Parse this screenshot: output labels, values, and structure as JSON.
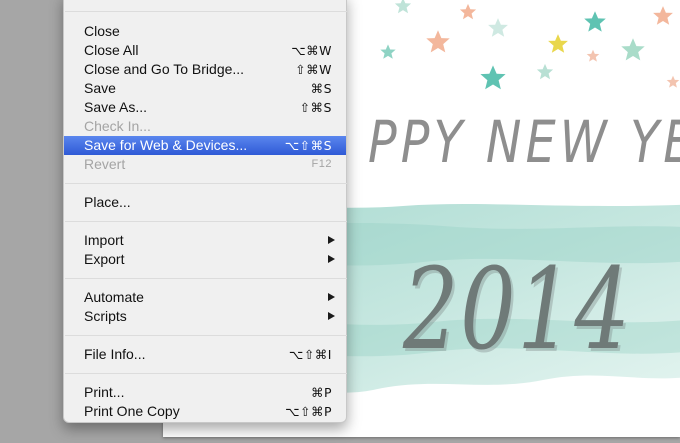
{
  "canvas": {
    "headline": "PPY NEW YEA",
    "year": "2014",
    "colors": {
      "wash": "#a9d8cf",
      "text": "#8e8e8e",
      "stars": [
        "#f2b9a0",
        "#7fcfc1",
        "#e6d64e",
        "#a8dccf"
      ]
    }
  },
  "file_menu": {
    "highlight_color": "#3a63d8",
    "items": [
      {
        "label": "Close",
        "shortcut": ""
      },
      {
        "label": "Close All",
        "shortcut": "⌥⌘W"
      },
      {
        "label": "Close and Go To Bridge...",
        "shortcut": "⇧⌘W"
      },
      {
        "label": "Save",
        "shortcut": "⌘S"
      },
      {
        "label": "Save As...",
        "shortcut": "⇧⌘S"
      },
      {
        "label": "Check In...",
        "shortcut": ""
      },
      {
        "label": "Save for Web & Devices...",
        "shortcut": "⌥⇧⌘S"
      },
      {
        "label": "Revert",
        "shortcut": "F12"
      },
      {
        "label": "Place...",
        "shortcut": ""
      },
      {
        "label": "Import",
        "shortcut": ""
      },
      {
        "label": "Export",
        "shortcut": ""
      },
      {
        "label": "Automate",
        "shortcut": ""
      },
      {
        "label": "Scripts",
        "shortcut": ""
      },
      {
        "label": "File Info...",
        "shortcut": "⌥⇧⌘I"
      },
      {
        "label": "Print...",
        "shortcut": "⌘P"
      },
      {
        "label": "Print One Copy",
        "shortcut": "⌥⇧⌘P"
      }
    ]
  }
}
